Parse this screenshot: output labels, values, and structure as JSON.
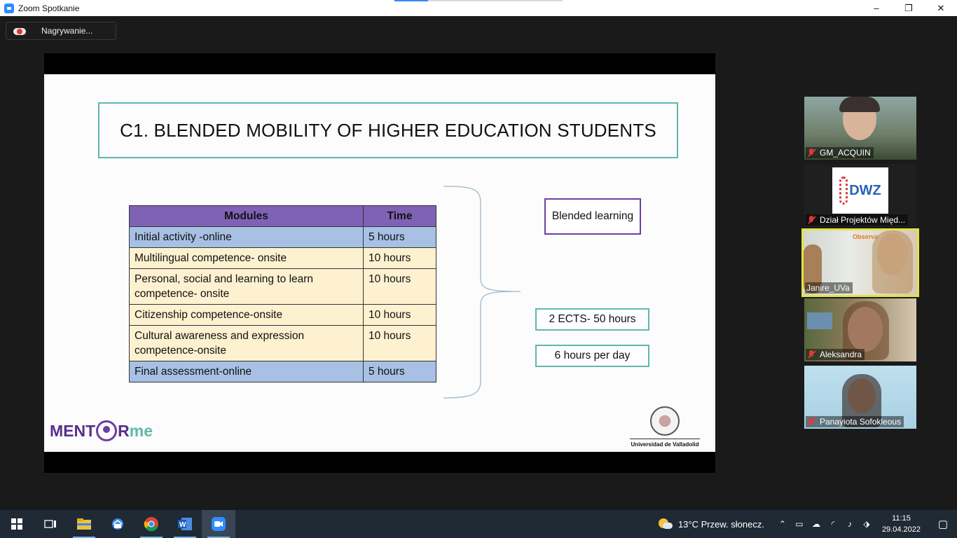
{
  "window": {
    "title": "Zoom Spotkanie",
    "minimize_glyph": "–",
    "restore_glyph": "❐",
    "close_glyph": "✕",
    "loading_progress": 0.2
  },
  "recording": {
    "label": "Nagrywanie..."
  },
  "slide": {
    "title": "C1. BLENDED MOBILITY OF HIGHER EDUCATION STUDENTS",
    "table": {
      "headers": [
        "Modules",
        "Time"
      ],
      "rows": [
        {
          "module": "Initial activity -online",
          "time": "5 hours",
          "color": "#a7c0e4"
        },
        {
          "module": "Multilingual competence- onsite",
          "time": "10 hours",
          "color": "#fdf1d0"
        },
        {
          "module": "Personal, social and learning to learn competence- onsite",
          "time": "10 hours",
          "color": "#fdf1d0"
        },
        {
          "module": "Citizenship competence-onsite",
          "time": "10 hours",
          "color": "#fdf1d0"
        },
        {
          "module": "Cultural awareness and expression competence-onsite",
          "time": "10 hours",
          "color": "#fdf1d0"
        },
        {
          "module": "Final assessment-online",
          "time": "5 hours",
          "color": "#a7c0e4"
        }
      ]
    },
    "blended_label": "Blended learning",
    "ects_label": "2 ECTS- 50 hours",
    "per_day_label": "6 hours per day",
    "logo_mentor_a": "MENT",
    "logo_mentor_b": "R",
    "logo_mentor_c": "me",
    "university": "Universidad de Valladolid"
  },
  "participants": [
    {
      "name": "GM_ACQUIN",
      "muted": true
    },
    {
      "name": "Dział Projektów Międ...",
      "muted": true,
      "logo_text": "DWZ"
    },
    {
      "name": "Janire_UVa",
      "muted": false,
      "active_speaker": true,
      "bg_text": "Observa"
    },
    {
      "name": "Aleksandra",
      "muted": true
    },
    {
      "name": "Panayiota Sofokleous",
      "muted": true
    }
  ],
  "taskbar": {
    "apps": [
      "start-icon",
      "task-view-icon",
      "file-explorer-icon",
      "outlook-icon",
      "chrome-icon",
      "word-icon",
      "zoom-icon"
    ],
    "weather": "13°C  Przew. słonecz.",
    "time": "11:15",
    "date": "29.04.2022"
  },
  "colors": {
    "accent_teal": "#5fb8ad",
    "accent_purple": "#6b3fa0",
    "table_header": "#7f62b6",
    "active_speaker_border": "#e2e24a"
  }
}
